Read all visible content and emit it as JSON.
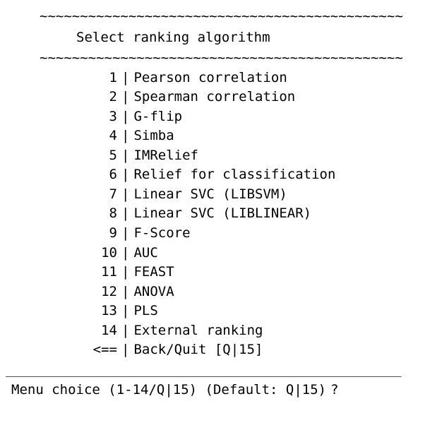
{
  "decor": {
    "wavy": "~~~~~~~~~~~~~~~~~~~~~~~~~~~~~~~~~~~~~~~~~~~~~",
    "rule": "_________________________________________________"
  },
  "header": {
    "title": "Select ranking algorithm"
  },
  "menu": {
    "separator": "|",
    "items": [
      {
        "key": "1",
        "label": "Pearson correlation"
      },
      {
        "key": "2",
        "label": "Spearman correlation"
      },
      {
        "key": "3",
        "label": "G-flip"
      },
      {
        "key": "4",
        "label": "Simba"
      },
      {
        "key": "5",
        "label": "IMRelief"
      },
      {
        "key": "6",
        "label": "Relief for classification"
      },
      {
        "key": "7",
        "label": "Linear SVC (LIBSVM)"
      },
      {
        "key": "8",
        "label": "Linear SVC (LIBLINEAR)"
      },
      {
        "key": "9",
        "label": "F-Score"
      },
      {
        "key": "10",
        "label": "AUC"
      },
      {
        "key": "11",
        "label": "FEAST"
      },
      {
        "key": "12",
        "label": "ANOVA"
      },
      {
        "key": "13",
        "label": "PLS"
      },
      {
        "key": "14",
        "label": "External ranking"
      },
      {
        "key": "<==",
        "label": "Back/Quit [Q|15]"
      }
    ]
  },
  "prompt": {
    "text": "Menu choice (1-14/Q|15) (Default: Q|15)",
    "marker": "?",
    "input_value": ""
  }
}
